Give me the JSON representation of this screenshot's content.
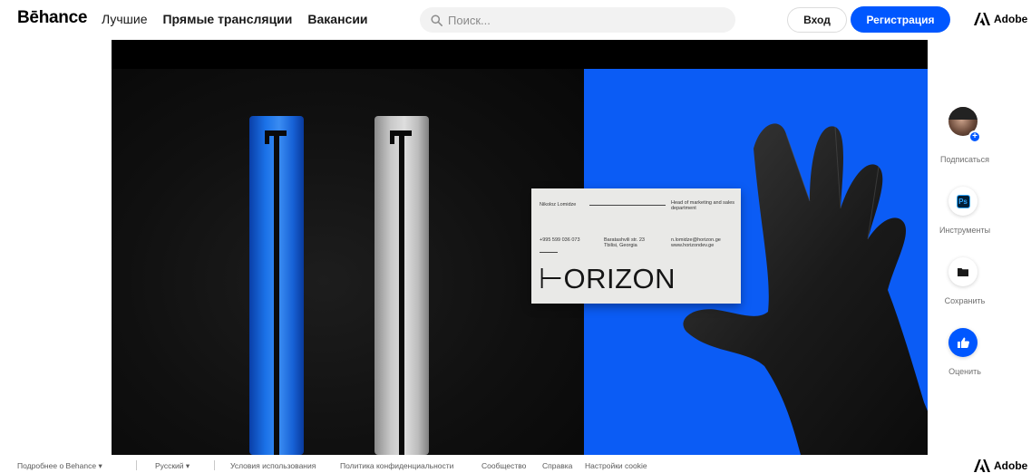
{
  "header": {
    "logo": "Bēhance",
    "nav": [
      "Лучшие",
      "Прямые трансляции",
      "Вакансии"
    ],
    "search_placeholder": "Поиск...",
    "login_label": "Вход",
    "signup_label": "Регистрация",
    "adobe_label": "Adobe"
  },
  "artwork": {
    "card": {
      "name": "Nikoloz Lomidze",
      "role": "Head of marketing and sales department",
      "phone": "+995 599 036 073",
      "address": "Baratashvili str. 23 Tbilisi, Georgia",
      "email": "n.lomidze@horizon.ge www.horizondev.ge",
      "logo": "⊢ORIZON"
    }
  },
  "side_actions": {
    "subscribe_label": "Подписаться",
    "tools_label": "Инструменты",
    "tools_icon_text": "Ps",
    "save_label": "Сохранить",
    "rate_label": "Оценить"
  },
  "footer": {
    "about": "Подробнее о Behance",
    "language": "Русский",
    "links": [
      "Условия использования",
      "Политика конфиденциальности",
      "Сообщество",
      "Справка",
      "Настройки cookie"
    ],
    "adobe_label": "Adobe"
  },
  "colors": {
    "accent": "#0057ff",
    "artwork_blue": "#0b5cf5"
  }
}
